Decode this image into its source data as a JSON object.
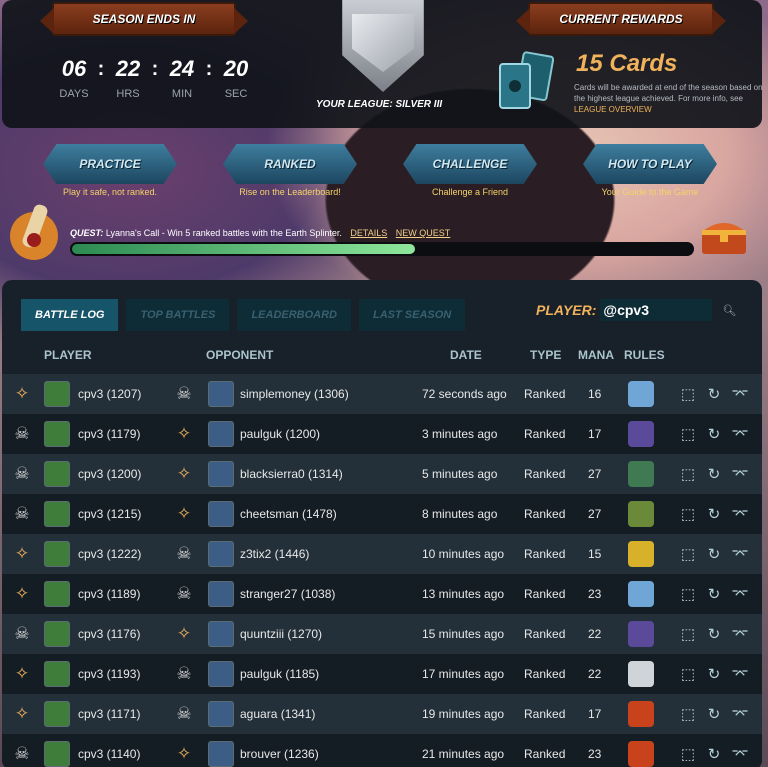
{
  "season": {
    "title": "SEASON ENDS IN",
    "timer": [
      {
        "value": "06",
        "label": "DAYS"
      },
      {
        "value": "22",
        "label": "HRS"
      },
      {
        "value": "24",
        "label": "MIN"
      },
      {
        "value": "20",
        "label": "SEC"
      }
    ],
    "separator": ":"
  },
  "league": {
    "label": "YOUR LEAGUE: SILVER III"
  },
  "rewards": {
    "title": "CURRENT REWARDS",
    "count": "15 Cards",
    "desc": "Cards will be awarded at end of the season based on the highest league achieved. For more info, see",
    "link": "LEAGUE OVERVIEW"
  },
  "modes": [
    {
      "label": "PRACTICE",
      "sub": "Play it safe, not ranked."
    },
    {
      "label": "RANKED",
      "sub": "Rise on the Leaderboard!"
    },
    {
      "label": "CHALLENGE",
      "sub": "Challenge a Friend"
    },
    {
      "label": "HOW TO PLAY",
      "sub": "Your Guide to the Game"
    }
  ],
  "quest": {
    "label": "QUEST:",
    "text": "Lyanna's Call - Win 5 ranked battles with the Earth Splinter.",
    "details": "DETAILS",
    "new_quest": "NEW QUEST",
    "progress": 0.55
  },
  "tabs": [
    "BATTLE LOG",
    "TOP BATTLES",
    "LEADERBOARD",
    "LAST SEASON"
  ],
  "player_search": {
    "label": "PLAYER:",
    "value": "@cpv3"
  },
  "columns": {
    "player": "PLAYER",
    "opponent": "OPPONENT",
    "date": "DATE",
    "type": "TYPE",
    "mana": "MANA",
    "rules": "RULES"
  },
  "battles": [
    {
      "result": "win",
      "player": "cpv3 (1207)",
      "opponent": "simplemoney (1306)",
      "date": "72 seconds ago",
      "type": "Ranked",
      "mana": "16",
      "rule_icon": "viking-helmet-icon"
    },
    {
      "result": "loss",
      "player": "cpv3 (1179)",
      "opponent": "paulguk (1200)",
      "date": "3 minutes ago",
      "type": "Ranked",
      "mana": "17",
      "rule_icon": "hooded-figure-icon"
    },
    {
      "result": "loss",
      "player": "cpv3 (1200)",
      "opponent": "blacksierra0 (1314)",
      "date": "5 minutes ago",
      "type": "Ranked",
      "mana": "27",
      "rule_icon": "cards-icon"
    },
    {
      "result": "loss",
      "player": "cpv3 (1215)",
      "opponent": "cheetsman (1478)",
      "date": "8 minutes ago",
      "type": "Ranked",
      "mana": "27",
      "rule_icon": "goblin-icon"
    },
    {
      "result": "win",
      "player": "cpv3 (1222)",
      "opponent": "z3tix2 (1446)",
      "date": "10 minutes ago",
      "type": "Ranked",
      "mana": "15",
      "rule_icon": "sun-eclipse-icon"
    },
    {
      "result": "win",
      "player": "cpv3 (1189)",
      "opponent": "stranger27 (1038)",
      "date": "13 minutes ago",
      "type": "Ranked",
      "mana": "23",
      "rule_icon": "viking-helmet-icon"
    },
    {
      "result": "loss",
      "player": "cpv3 (1176)",
      "opponent": "quuntziii (1270)",
      "date": "15 minutes ago",
      "type": "Ranked",
      "mana": "22",
      "rule_icon": "hooded-figure-icon"
    },
    {
      "result": "win",
      "player": "cpv3 (1193)",
      "opponent": "paulguk (1185)",
      "date": "17 minutes ago",
      "type": "Ranked",
      "mana": "22",
      "rule_icon": "cloud-icon"
    },
    {
      "result": "win",
      "player": "cpv3 (1171)",
      "opponent": "aguara (1341)",
      "date": "19 minutes ago",
      "type": "Ranked",
      "mana": "17",
      "rule_icon": "banner-icon"
    },
    {
      "result": "loss",
      "player": "cpv3 (1140)",
      "opponent": "brouver (1236)",
      "date": "21 minutes ago",
      "type": "Ranked",
      "mana": "23",
      "rule_icon": "banner-icon"
    }
  ],
  "colors": {
    "accent": "#f0b35c",
    "panel": "#18202a",
    "tab_active": "#155469"
  }
}
